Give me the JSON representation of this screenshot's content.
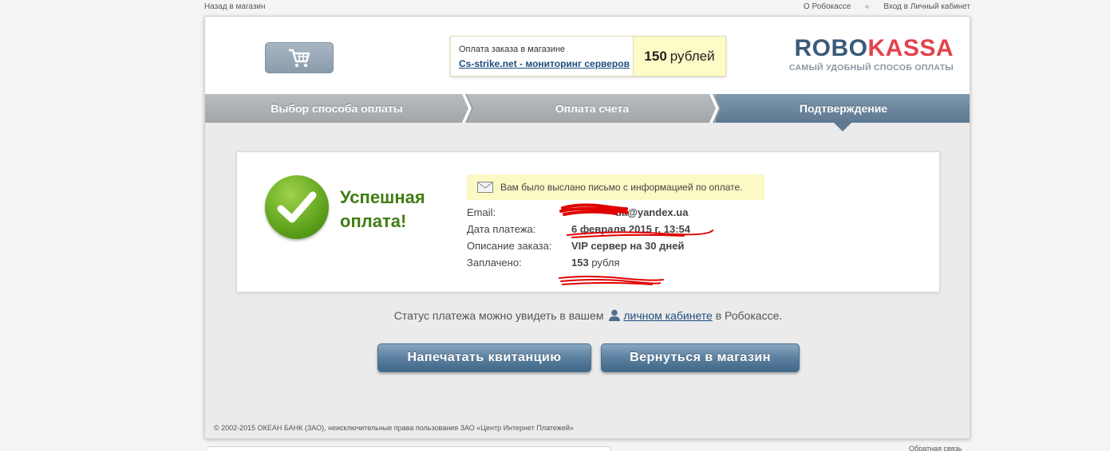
{
  "toplinks": {
    "back": "Назад в магазин",
    "about": "О Робокассе",
    "login": "Вход в Личный кабинет"
  },
  "order": {
    "title": "Оплата заказа в магазине",
    "shop_link": "Cs-strike.net - мониторинг серверов",
    "price_amount": "150",
    "price_unit": "рублей"
  },
  "logo": {
    "robo": "ROBO",
    "kassa": "KASSA",
    "tagline": "САМЫЙ УДОБНЫЙ СПОСОБ ОПЛАТЫ"
  },
  "steps": [
    {
      "label": "Выбор способа оплаты"
    },
    {
      "label": "Оплата счета"
    },
    {
      "label": "Подтверждение"
    }
  ],
  "result": {
    "title_line1": "Успешная",
    "title_line2": "оплата!",
    "notice": "Вам было выслано письмо с информацией по оплате.",
    "rows": [
      {
        "label": "Email:",
        "value": "ua@yandex.ua"
      },
      {
        "label": "Дата платежа:",
        "value": "6 февраля 2015 г. 13:54"
      },
      {
        "label": "Описание заказа:",
        "value": "VIP сервер на 30 дней"
      },
      {
        "label": "Заплачено:",
        "value": "153",
        "unit": "рубля"
      }
    ]
  },
  "status": {
    "before": "Статус платежа можно увидеть в вашем",
    "link": "личном кабинете",
    "after": "в Робокассе."
  },
  "buttons": {
    "print": "Напечатать квитанцию",
    "back": "Вернуться в магазин"
  },
  "footer": {
    "copyright": "© 2002-2015 ОКЕАН БАНК (ЗАО), неисключительные права пользования ЗАО «Центр Интернет Платежей»",
    "feedback": "Обратная связь"
  },
  "colors": {
    "accent": "#5c80a0",
    "success": "#3f7e12",
    "brand_red": "#e2434c",
    "brand_blue": "#3a5a78"
  }
}
